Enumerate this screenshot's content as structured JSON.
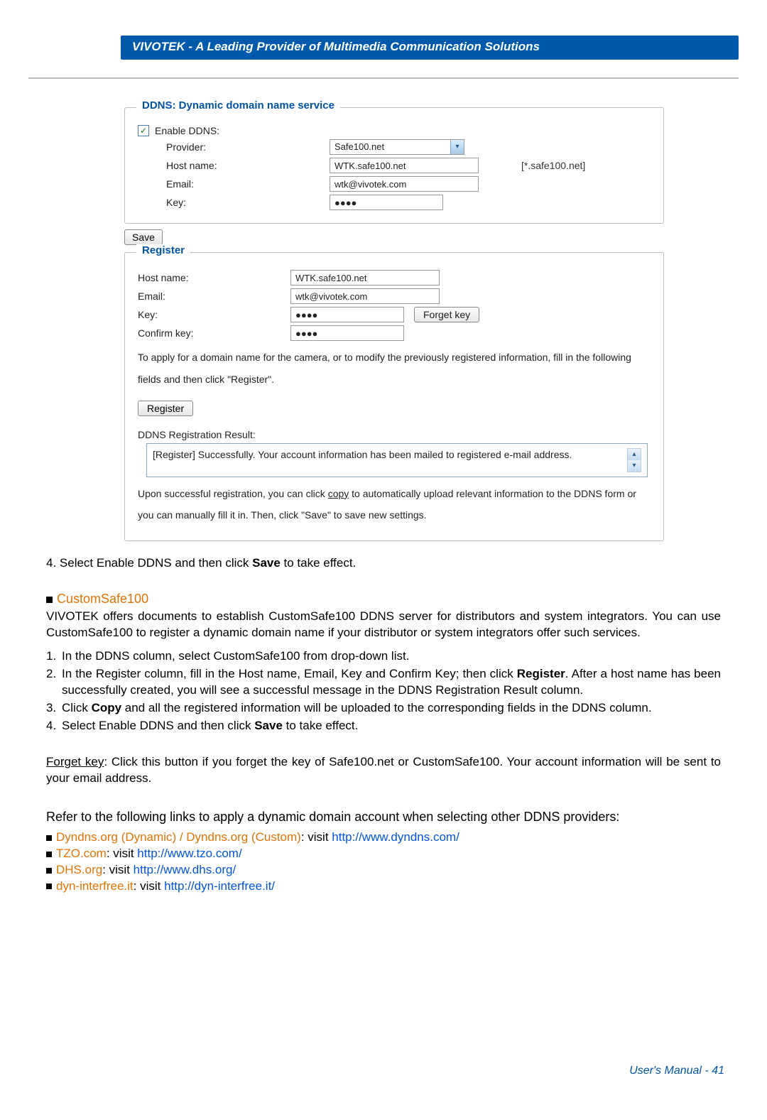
{
  "banner": "VIVOTEK - A Leading Provider of Multimedia Communication Solutions",
  "ddns": {
    "legend": "DDNS: Dynamic domain name service",
    "enable_checked": "✓",
    "enable_label": "Enable DDNS:",
    "provider_label": "Provider:",
    "provider_value": "Safe100.net",
    "host_label": "Host name:",
    "host_value": "WTK.safe100.net",
    "host_suffix": "[*.safe100.net]",
    "email_label": "Email:",
    "email_value": "wtk@vivotek.com",
    "key_label": "Key:",
    "key_value": "●●●●"
  },
  "save_label": "Save",
  "register": {
    "legend": "Register",
    "host_label": "Host name:",
    "host_value": "WTK.safe100.net",
    "email_label": "Email:",
    "email_value": "wtk@vivotek.com",
    "key_label": "Key:",
    "key_value": "●●●●",
    "forget_label": "Forget key",
    "confirm_label": "Confirm key:",
    "confirm_value": "●●●●",
    "note": "To apply for a domain name for the camera, or to modify the previously registered information, fill in the following fields and then click \"Register\".",
    "register_label": "Register",
    "result_title": "DDNS Registration Result:",
    "result_text": "[Register] Successfully. Your account information has been mailed to registered e-mail address.",
    "post1a": "Upon successful registration, you can click ",
    "post1_link": "copy",
    "post1b": " to automatically upload relevant information to the DDNS form or you can manually fill it in. Then, click \"Save\" to save new settings."
  },
  "body": {
    "step4a": "4. Select Enable DDNS and then click ",
    "step4b": "Save",
    "step4c": " to take effect.",
    "cs_title": "CustomSafe100",
    "cs_para": "VIVOTEK offers documents to establish CustomSafe100 DDNS server for distributors and system integrators. You can use CustomSafe100 to register a dynamic domain name if your distributor or system integrators offer such services.",
    "l1": "In the DDNS column, select CustomSafe100 from drop-down list.",
    "l2a": "In the Register column, fill in the Host name, Email, Key and Confirm Key; then click ",
    "l2b": "Register",
    "l2c": ". After a host name has been successfully created, you will see a successful message in the DDNS Registration Result column.",
    "l3a": "Click ",
    "l3b": "Copy",
    "l3c": " and all the registered information will be uploaded to the corresponding fields in the DDNS column.",
    "l4a": "Select Enable DDNS and then click ",
    "l4b": "Save",
    "l4c": " to take effect.",
    "forget_head": "Forget key",
    "forget_body": ": Click this button if you forget the key of Safe100.net or CustomSafe100. Your account information will be sent to your email address.",
    "refer": "Refer to the following links to apply a dynamic domain account when selecting other DDNS providers:",
    "link1a": "Dyndns.org (Dynamic) / Dyndns.org (Custom)",
    "link1b": ": visit ",
    "link1c": "http://www.dyndns.com/",
    "link2a": "TZO.com",
    "link2b": ": visit ",
    "link2c": "http://www.tzo.com/",
    "link3a": "DHS.org",
    "link3b": ": visit ",
    "link3c": "http://www.dhs.org/",
    "link4a": "dyn-interfree.it",
    "link4b": ": visit ",
    "link4c": "http://dyn-interfree.it/"
  },
  "footer": "User's Manual - 41"
}
